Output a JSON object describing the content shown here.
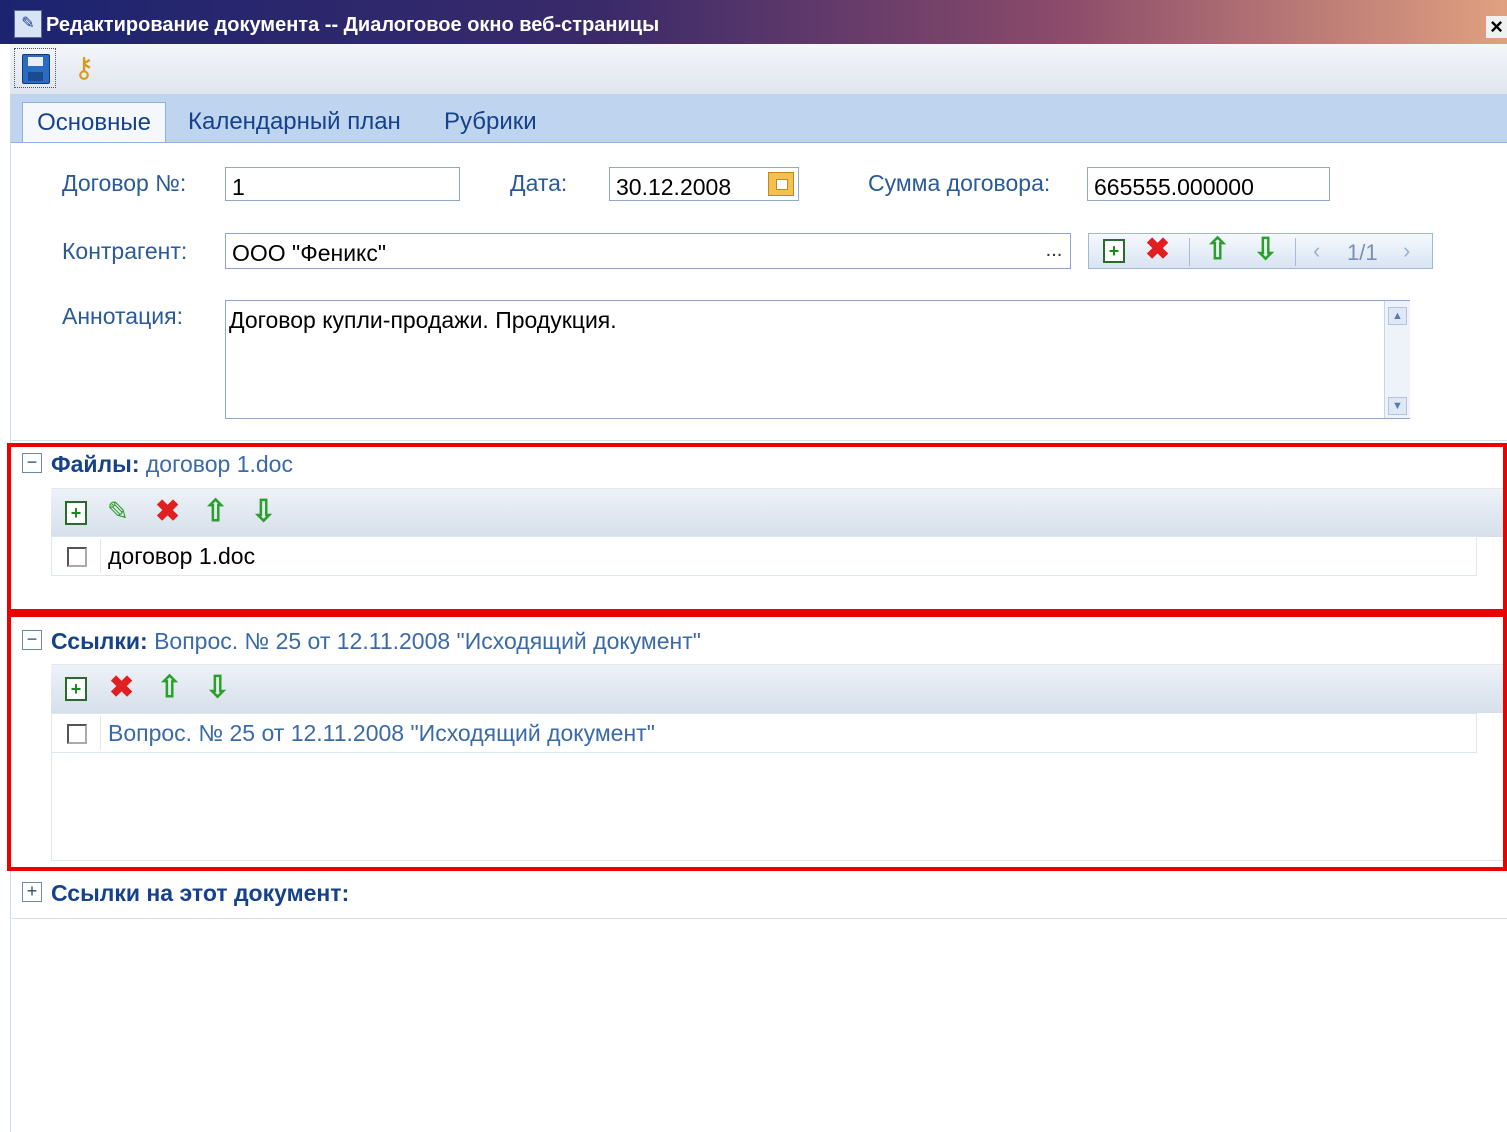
{
  "window": {
    "title": "Редактирование документа -- Диалоговое окно веб-страницы",
    "close_glyph": "×"
  },
  "toolbar": {
    "save_icon": "save-icon",
    "properties_icon": "key-icon"
  },
  "tabs": [
    {
      "label": "Основные",
      "active": true
    },
    {
      "label": "Календарный план",
      "active": false
    },
    {
      "label": "Рубрики",
      "active": false
    }
  ],
  "form": {
    "contract_no": {
      "label": "Договор №:",
      "value": "1"
    },
    "date": {
      "label": "Дата:",
      "value": "30.12.2008"
    },
    "sum": {
      "label": "Сумма договора:",
      "value": "665555.000000"
    },
    "counterparty": {
      "label": "Контрагент:",
      "value": "ООО \"Феникс\"",
      "browse": "..."
    },
    "pager": {
      "text": "1/1",
      "prev": "‹",
      "next": "›"
    },
    "annotation": {
      "label": "Аннотация:",
      "value": "Договор купли-продажи. Продукция."
    }
  },
  "files": {
    "title": "Файлы:",
    "summary": "договор 1.doc",
    "toggle": "−",
    "items": [
      {
        "name": "договор 1.doc"
      }
    ]
  },
  "links": {
    "title": "Ссылки:",
    "summary": "Вопрос. № 25 от 12.11.2008 \"Исходящий документ\"",
    "toggle": "−",
    "items": [
      {
        "name": "Вопрос. № 25 от 12.11.2008 \"Исходящий документ\""
      }
    ]
  },
  "backlinks": {
    "title": "Ссылки на этот документ:",
    "toggle": "+"
  },
  "colors": {
    "highlight": "#ee0000",
    "link_text": "#3a6aa8",
    "heading_text": "#15428b"
  }
}
